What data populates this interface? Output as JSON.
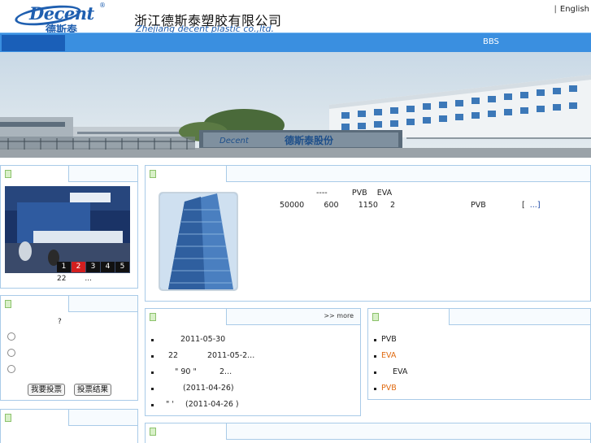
{
  "header": {
    "logo_word": "Decent",
    "logo_reg": "®",
    "logo_cn": "德斯泰",
    "company_cn": "浙江德斯泰塑胶有限公司",
    "company_en": "Zhejiang decent plastic co.,ltd.",
    "lang_sep": "|",
    "lang_link": "English"
  },
  "nav": {
    "bbs": "BBS"
  },
  "photo_box": {
    "pages": [
      "1",
      "2",
      "3",
      "4",
      "5"
    ],
    "active_page": "2",
    "caption_num": "22",
    "caption_more": "..."
  },
  "vote_box": {
    "question": "?",
    "submit_label": "我要投票",
    "result_label": "投票结果"
  },
  "about_box": {
    "line1_a": "----",
    "line1_b": "PVB",
    "line1_c": "EVA",
    "line2_a": "50000",
    "line2_b": "600",
    "line2_c": "1150",
    "line2_d": "2",
    "line2_e": "PVB",
    "line2_f": "[",
    "line2_link": "...]"
  },
  "news_box": {
    "more": ">> more",
    "items": [
      {
        "prefix": "",
        "text": "2011-05-30"
      },
      {
        "prefix": "22",
        "text": "2011-05-2..."
      },
      {
        "prefix": "\"  90  \"",
        "text": "2..."
      },
      {
        "prefix": "",
        "text": "(2011-04-26)"
      },
      {
        "prefix": "\"  '",
        "text": "(2011-04-26 )"
      }
    ]
  },
  "product_box": {
    "items": [
      {
        "text": "PVB",
        "orange": false
      },
      {
        "text": "EVA",
        "orange": true
      },
      {
        "text": "EVA",
        "orange": false
      },
      {
        "text": "PVB",
        "orange": true
      }
    ]
  },
  "colors": {
    "nav_blue": "#3a8fe0",
    "nav_dark": "#1a5fb8",
    "box_border": "#a9cbe8",
    "accent_orange": "#e06a10",
    "pager_active": "#d31f1f"
  }
}
